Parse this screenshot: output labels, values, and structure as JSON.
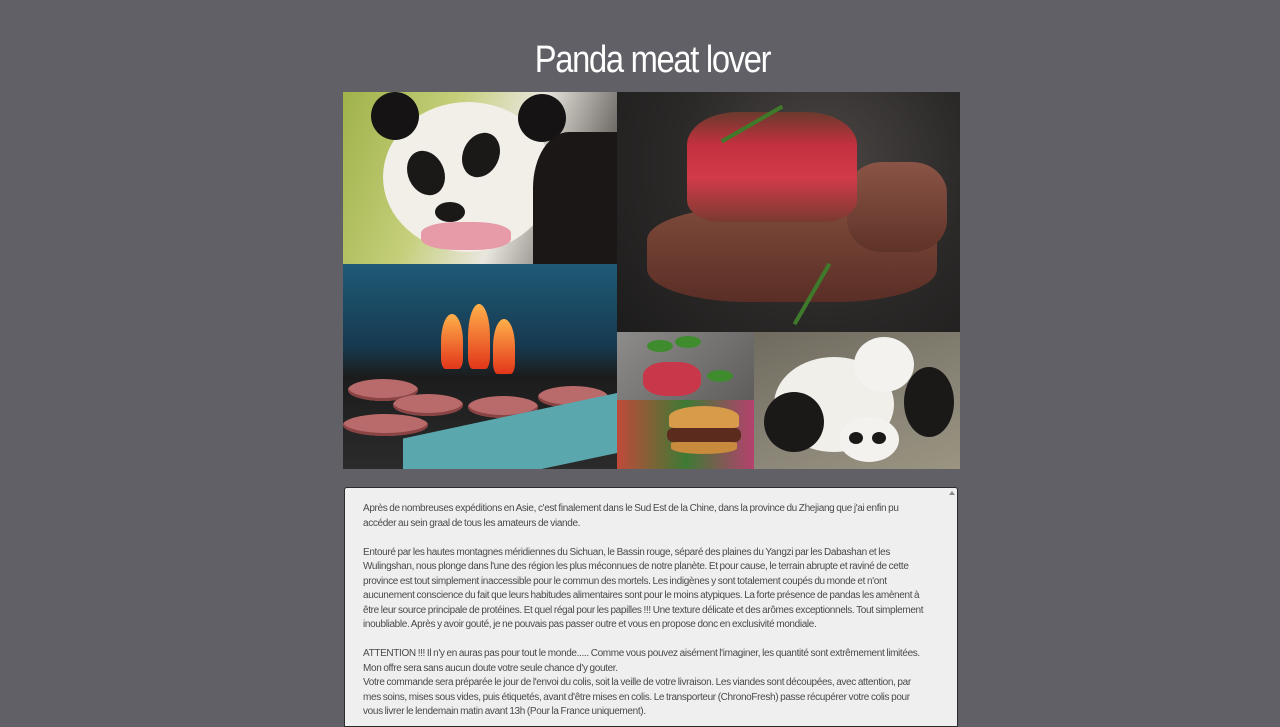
{
  "page": {
    "title": "Panda meat lover"
  },
  "collage": {
    "tiles": [
      {
        "id": "panda-eating",
        "caption": ""
      },
      {
        "id": "steak",
        "caption": ""
      },
      {
        "id": "grill",
        "caption": ""
      },
      {
        "id": "raw-meat-herbs",
        "caption": ""
      },
      {
        "id": "burger",
        "caption": ""
      },
      {
        "id": "two-pandas",
        "caption": ""
      }
    ]
  },
  "description": {
    "p1": "Après de nombreuses expéditions en Asie, c'est finalement dans le Sud Est de la Chine, dans la province du Zhejiang que j'ai enfin pu accéder au sein graal de tous les amateurs de viande.",
    "p2": "Entouré par les hautes montagnes méridiennes du Sichuan, le Bassin rouge, séparé des plaines du Yangzi par les Dabashan et les Wulingshan, nous plonge dans l'une des région les plus méconnues de notre planète. Et pour cause, le terrain abrupte et raviné de cette province est tout simplement inaccessible pour le commun des mortels. Les indigènes y sont totalement coupés du monde et n'ont aucunement conscience du fait que leurs habitudes alimentaires sont pour le moins atypiques. La forte présence de pandas les amènent à être leur source principale de protéines. Et quel régal pour les papilles !!! Une texture délicate et des arômes exceptionnels. Tout simplement inoubliable. Après y avoir gouté, je ne pouvais pas passer outre et vous en propose donc en exclusivité mondiale.",
    "p3": "ATTENTION !!! Il n'y en auras pas pour tout le monde..... Comme vous pouvez aisément l'imaginer, les quantité sont extrêmement limitées. Mon offre sera sans aucun doute votre seule chance d'y gouter.",
    "p4": "Votre commande sera préparée le jour de l'envoi du colis, soit la veille de votre livraison. Les viandes sont découpées, avec attention, par mes soins, mises sous vides, puis étiquetés, avant d'être mises en colis. Le transporteur (ChronoFresh) passe récupérer votre colis pour vous livrer le lendemain matin avant 13h (Pour la France uniquement)."
  }
}
